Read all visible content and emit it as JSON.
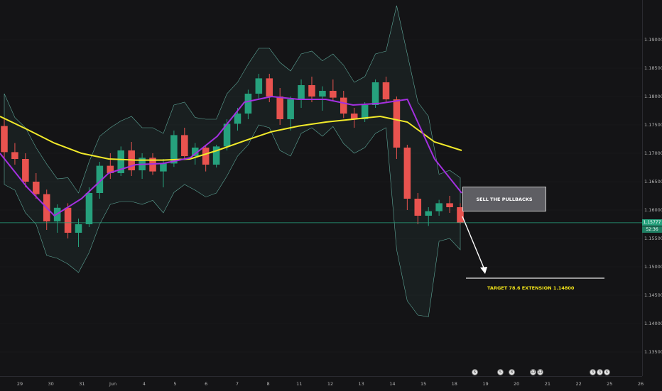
{
  "chart_data": {
    "type": "candlestick",
    "symbol_hint": "EUR/USD style FX pair",
    "y_axis": {
      "ticks": [
        "1.19000",
        "1.18500",
        "1.18000",
        "1.17500",
        "1.17000",
        "1.16500",
        "1.16000",
        "1.15500",
        "1.15000",
        "1.14500",
        "1.14000",
        "1.13500"
      ],
      "ylim": [
        1.132,
        1.196
      ]
    },
    "x_axis": {
      "ticks": [
        "29",
        "30",
        "31",
        "Jun",
        "4",
        "5",
        "6",
        "7",
        "8",
        "11",
        "12",
        "13",
        "14",
        "15",
        "18",
        "19",
        "20",
        "21",
        "22",
        "25",
        "26"
      ]
    },
    "current_price": "1.15777",
    "countdown": "52:36",
    "annotations": {
      "note": "SELL THE PULLBACKS",
      "target": "TARGET 78.6 EXTENSION 1.14800"
    },
    "series": [
      {
        "kind": "moving_average",
        "color": "#f2ea2a",
        "values": [
          1.1765,
          1.1742,
          1.1718,
          1.17,
          1.169,
          1.1688,
          1.1688,
          1.169,
          1.1705,
          1.1722,
          1.1738,
          1.1748,
          1.1755,
          1.176,
          1.1765,
          1.1755,
          1.172,
          1.1705
        ]
      },
      {
        "kind": "moving_average",
        "color": "#a430e0",
        "values": [
          1.17,
          1.164,
          1.159,
          1.162,
          1.1665,
          1.168,
          1.1682,
          1.1692,
          1.173,
          1.179,
          1.18,
          1.1795,
          1.1795,
          1.1785,
          1.1788,
          1.1795,
          1.169,
          1.163
        ]
      },
      {
        "kind": "bollinger_bands",
        "color": "#5fa89a"
      }
    ],
    "ohlc": [
      [
        1.1748,
        1.176,
        1.169,
        1.1702
      ],
      [
        1.1702,
        1.1718,
        1.168,
        1.169
      ],
      [
        1.169,
        1.17,
        1.164,
        1.165
      ],
      [
        1.165,
        1.1665,
        1.162,
        1.1628
      ],
      [
        1.1628,
        1.1636,
        1.1565,
        1.158
      ],
      [
        1.158,
        1.161,
        1.156,
        1.1604
      ],
      [
        1.1604,
        1.1612,
        1.155,
        1.156
      ],
      [
        1.156,
        1.1585,
        1.1535,
        1.1575
      ],
      [
        1.1575,
        1.164,
        1.157,
        1.163
      ],
      [
        1.163,
        1.1685,
        1.162,
        1.1678
      ],
      [
        1.1678,
        1.17,
        1.1655,
        1.1665
      ],
      [
        1.1665,
        1.1712,
        1.166,
        1.1705
      ],
      [
        1.1705,
        1.172,
        1.166,
        1.167
      ],
      [
        1.167,
        1.17,
        1.1655,
        1.1692
      ],
      [
        1.1692,
        1.17,
        1.1662,
        1.1668
      ],
      [
        1.1668,
        1.169,
        1.164,
        1.1682
      ],
      [
        1.1682,
        1.174,
        1.1676,
        1.1732
      ],
      [
        1.1732,
        1.1745,
        1.169,
        1.1695
      ],
      [
        1.1695,
        1.1718,
        1.168,
        1.171
      ],
      [
        1.171,
        1.1715,
        1.1668,
        1.168
      ],
      [
        1.168,
        1.1715,
        1.1675,
        1.1712
      ],
      [
        1.1712,
        1.176,
        1.1705,
        1.1752
      ],
      [
        1.1752,
        1.178,
        1.174,
        1.177
      ],
      [
        1.177,
        1.1812,
        1.176,
        1.1805
      ],
      [
        1.1805,
        1.184,
        1.1795,
        1.1832
      ],
      [
        1.1832,
        1.184,
        1.179,
        1.18
      ],
      [
        1.18,
        1.1815,
        1.175,
        1.176
      ],
      [
        1.176,
        1.18,
        1.174,
        1.1795
      ],
      [
        1.1795,
        1.183,
        1.178,
        1.182
      ],
      [
        1.182,
        1.1835,
        1.179,
        1.18
      ],
      [
        1.18,
        1.1818,
        1.1775,
        1.181
      ],
      [
        1.181,
        1.183,
        1.1792,
        1.1798
      ],
      [
        1.1798,
        1.181,
        1.1762,
        1.177
      ],
      [
        1.177,
        1.178,
        1.1745,
        1.176
      ],
      [
        1.176,
        1.179,
        1.1755,
        1.1785
      ],
      [
        1.1785,
        1.183,
        1.178,
        1.1825
      ],
      [
        1.1825,
        1.1835,
        1.179,
        1.1795
      ],
      [
        1.1795,
        1.18,
        1.169,
        1.171
      ],
      [
        1.171,
        1.1715,
        1.16,
        1.162
      ],
      [
        1.162,
        1.163,
        1.1575,
        1.159
      ],
      [
        1.159,
        1.1605,
        1.1572,
        1.1598
      ],
      [
        1.1598,
        1.1618,
        1.159,
        1.1612
      ],
      [
        1.1612,
        1.1625,
        1.1595,
        1.1605
      ],
      [
        1.1605,
        1.1612,
        1.1575,
        1.1578
      ]
    ]
  },
  "events": [
    {
      "label": "6"
    },
    {
      "label": "5"
    },
    {
      "label": "8"
    },
    {
      "label": "12"
    },
    {
      "label": "12"
    },
    {
      "label": "3"
    },
    {
      "label": "3"
    },
    {
      "label": "6"
    }
  ]
}
